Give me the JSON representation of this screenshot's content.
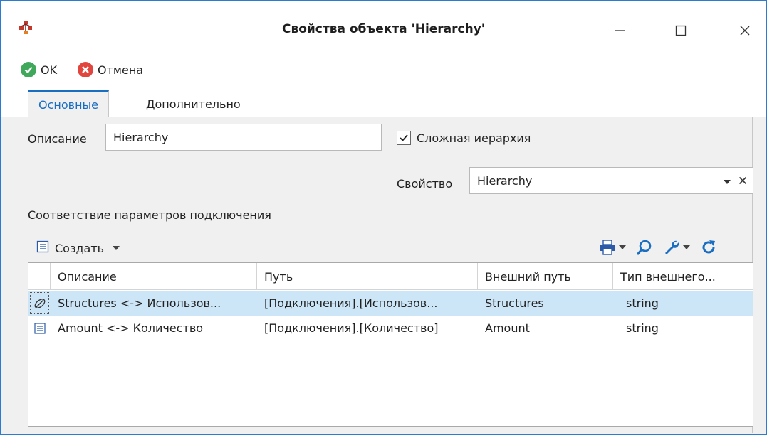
{
  "window": {
    "title": "Свойства объекта 'Hierarchy'"
  },
  "actions": {
    "ok_label": "OK",
    "cancel_label": "Отмена"
  },
  "tabs": [
    {
      "label": "Основные",
      "active": true
    },
    {
      "label": "Дополнительно",
      "active": false
    }
  ],
  "form": {
    "description_label": "Описание",
    "description_value": "Hierarchy",
    "complex_hierarchy_label": "Сложная иерархия",
    "complex_hierarchy_checked": true,
    "property_label": "Свойство",
    "property_value": "Hierarchy"
  },
  "mapping": {
    "section_title": "Соответствие параметров подключения",
    "create_label": "Создать",
    "columns": [
      "Описание",
      "Путь",
      "Внешний путь",
      "Тип внешнего..."
    ],
    "rows": [
      {
        "icon": "link-icon",
        "description": "Structures <-> Использов...",
        "path": "[Подключения].[Использов...",
        "external_path": "Structures",
        "external_type": "string",
        "selected": true
      },
      {
        "icon": "list-icon",
        "description": "Amount <-> Количество",
        "path": "[Подключения].[Количество]",
        "external_path": "Amount",
        "external_type": "string",
        "selected": false
      }
    ]
  },
  "colors": {
    "accent": "#1a6ec2",
    "selection": "#cde6f7",
    "ok_green": "#3fa85a",
    "cancel_red": "#e2453d",
    "window_border": "#2b7bd0"
  }
}
